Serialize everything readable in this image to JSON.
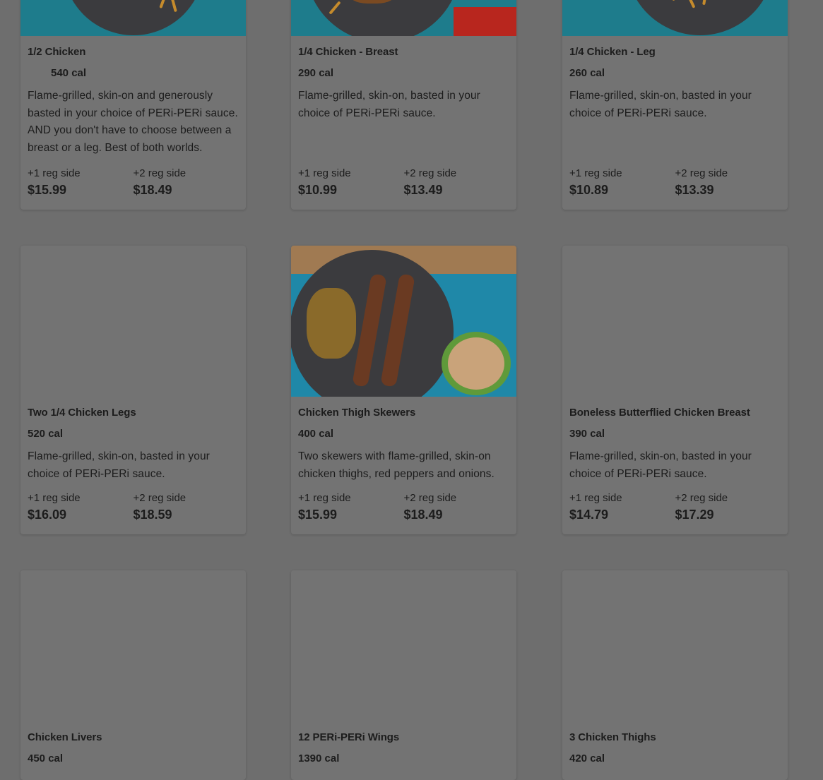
{
  "menu": {
    "items": [
      {
        "title": "1/2 Chicken",
        "cal": "540 cal",
        "desc": "Flame-grilled, skin-on and generously basted in your choice of PERi-PERi sauce. AND you don't have to choose between a breast or a leg. Best of both worlds.",
        "side1_label": "+1 reg side",
        "side1_price": "$15.99",
        "side2_label": "+2 reg side",
        "side2_price": "$18.49"
      },
      {
        "title": "1/4 Chicken - Breast",
        "cal": "290 cal",
        "desc": "Flame-grilled, skin-on, basted in your choice of PERi-PERi sauce.",
        "side1_label": "+1 reg side",
        "side1_price": "$10.99",
        "side2_label": "+2 reg side",
        "side2_price": "$13.49"
      },
      {
        "title": "1/4 Chicken - Leg",
        "cal": "260 cal",
        "desc": "Flame-grilled, skin-on, basted in your choice of PERi-PERi sauce.",
        "side1_label": "+1 reg side",
        "side1_price": "$10.89",
        "side2_label": "+2 reg side",
        "side2_price": "$13.39"
      },
      {
        "title": "Two 1/4 Chicken Legs",
        "cal": "520 cal",
        "desc": "Flame-grilled, skin-on, basted in your choice of PERi-PERi sauce.",
        "side1_label": "+1 reg side",
        "side1_price": "$16.09",
        "side2_label": "+2 reg side",
        "side2_price": "$18.59"
      },
      {
        "title": "Chicken Thigh Skewers",
        "cal": "400 cal",
        "desc": "Two skewers with flame-grilled, skin-on chicken thighs, red peppers and onions.",
        "side1_label": "+1 reg side",
        "side1_price": "$15.99",
        "side2_label": "+2 reg side",
        "side2_price": "$18.49"
      },
      {
        "title": "Boneless Butterflied Chicken Breast",
        "cal": "390 cal",
        "desc": "Flame-grilled, skin-on, basted in your choice of PERi-PERi sauce.",
        "side1_label": "+1 reg side",
        "side1_price": "$14.79",
        "side2_label": "+2 reg side",
        "side2_price": "$17.29"
      },
      {
        "title": "Chicken Livers",
        "cal": "450 cal"
      },
      {
        "title": "12 PERi-PERi Wings",
        "cal": "1390 cal"
      },
      {
        "title": "3 Chicken Thighs",
        "cal": "420 cal"
      }
    ]
  },
  "colors": {
    "overlay_bg": "#6e6e6e",
    "card_bg": "#737373",
    "text": "#1c1c1c",
    "plate_teal": "#1e7c8c"
  }
}
